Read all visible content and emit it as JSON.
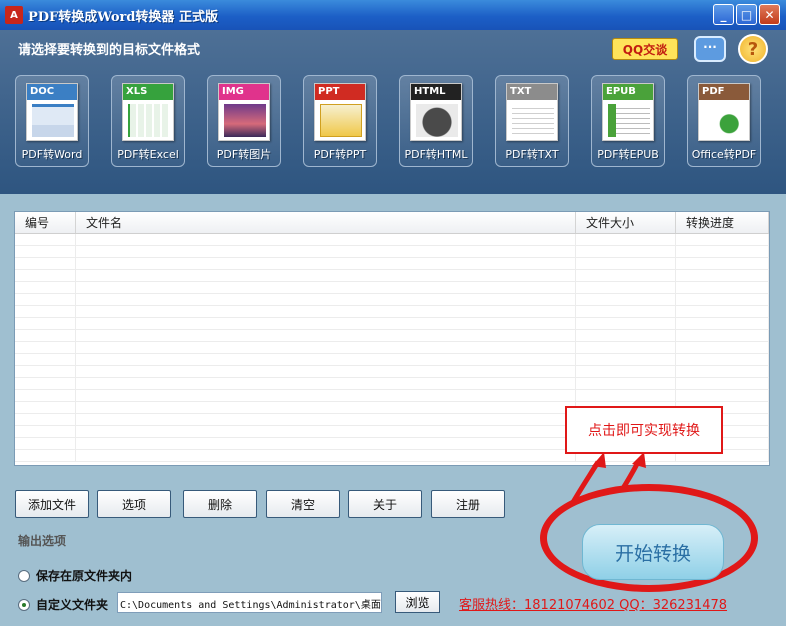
{
  "window": {
    "title": "PDF转换成Word转换器 正式版",
    "app_icon": "A"
  },
  "toolbar": {
    "heading": "请选择要转换到的目标文件格式",
    "qq_label": "QQ交谈",
    "formats": [
      {
        "tag": "DOC",
        "label": "PDF转Word",
        "color": "#3b7fc4",
        "icon": "word-doc-icon"
      },
      {
        "tag": "XLS",
        "label": "PDF转Excel",
        "color": "#36a23d",
        "icon": "excel-chart-icon"
      },
      {
        "tag": "IMG",
        "label": "PDF转图片",
        "color": "#e0338c",
        "icon": "image-icon"
      },
      {
        "tag": "PPT",
        "label": "PDF转PPT",
        "color": "#d02b22",
        "icon": "ppt-slide-icon"
      },
      {
        "tag": "HTML",
        "label": "PDF转HTML",
        "color": "#222222",
        "icon": "globe-icon"
      },
      {
        "tag": "TXT",
        "label": "PDF转TXT",
        "color": "#8c8c8c",
        "icon": "text-pen-icon"
      },
      {
        "tag": "EPUB",
        "label": "PDF转EPUB",
        "color": "#4aa23a",
        "icon": "epub-icon"
      },
      {
        "tag": "PDF",
        "label": "Office转PDF",
        "color": "#8a5a3a",
        "icon": "acrobat-check-icon"
      }
    ]
  },
  "file_list": {
    "columns": [
      "编号",
      "文件名",
      "文件大小",
      "转换进度"
    ],
    "rows": []
  },
  "actions": {
    "add_file": "添加文件",
    "options": "选项",
    "delete": "删除",
    "clear": "清空",
    "about": "关于",
    "register": "注册"
  },
  "output": {
    "title": "输出选项",
    "option_source": "保存在原文件夹内",
    "option_custom": "自定义文件夹",
    "selected": "custom",
    "path": "C:\\Documents and Settings\\Administrator\\桌面",
    "browse": "浏览"
  },
  "hotline": "客服热线：18121074602 QQ：326231478",
  "callout": "点击即可实现转换",
  "start_button": "开始转换",
  "colors": {
    "highlight": "#e01818",
    "panel": "#3a5f89",
    "background": "#9fbfd0"
  }
}
